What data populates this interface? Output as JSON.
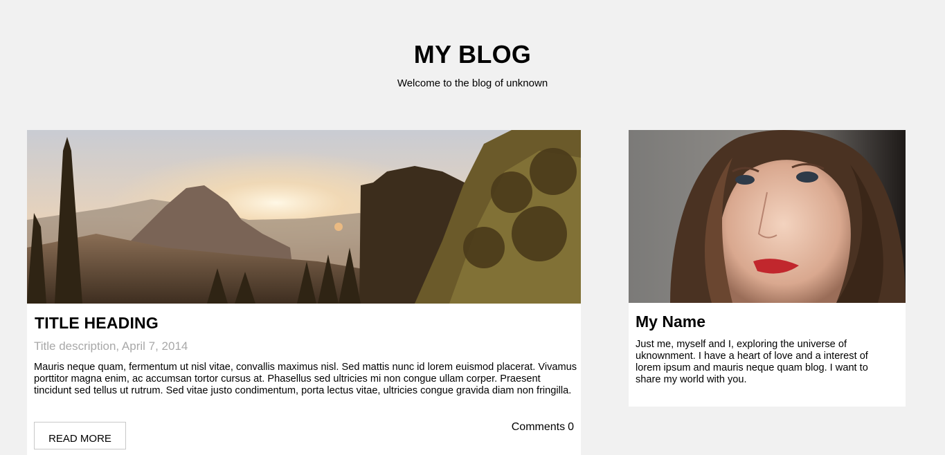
{
  "header": {
    "title": "MY BLOG",
    "subtitle": "Welcome to the blog of unknown"
  },
  "post": {
    "image": "sunset-mountain-forest-photo",
    "title": "TITLE HEADING",
    "meta": "Title description, April 7, 2014",
    "body": "Mauris neque quam, fermentum ut nisl vitae, convallis maximus nisl. Sed mattis nunc id lorem euismod placerat. Vivamus porttitor magna enim, ac accumsan tortor cursus at. Phasellus sed ultricies mi non congue ullam corper. Praesent tincidunt sed tellus ut rutrum. Sed vitae justo condimentum, porta lectus vitae, ultricies congue gravida diam non fringilla.",
    "read_more_label": "READ MORE",
    "comments_label": "Comments",
    "comments_count": "0"
  },
  "sidebar": {
    "image": "woman-portrait-photo",
    "name": "My Name",
    "bio": "Just me, myself and I, exploring the universe of uknownment. I have a heart of love and a interest of lorem ipsum and mauris neque quam blog. I want to share my world with you."
  },
  "colors": {
    "page_background": "#f1f1f1",
    "card_background": "#ffffff",
    "meta_text": "#a8a8a8"
  }
}
